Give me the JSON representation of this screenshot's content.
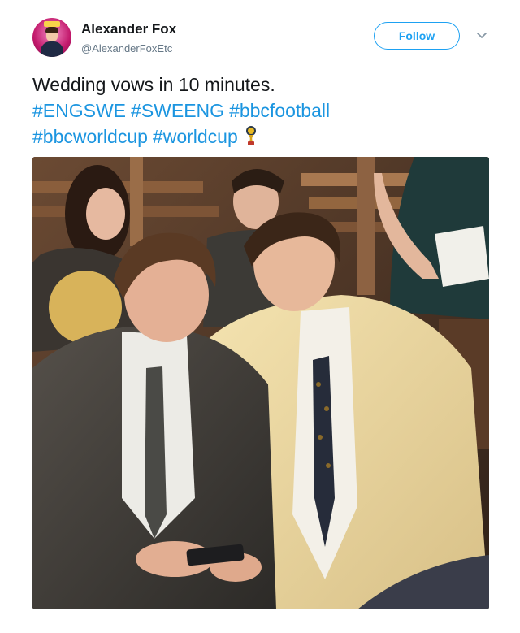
{
  "user": {
    "name": "Alexander Fox",
    "handle": "@AlexanderFoxEtc",
    "avatar_icon": "profile-avatar"
  },
  "actions": {
    "follow_label": "Follow",
    "menu_icon": "chevron-down-icon"
  },
  "tweet": {
    "line1": "Wedding vows in 10 minutes.",
    "hashtags_line2": [
      "#ENGSWE",
      "#SWEENG",
      "#bbcfootball"
    ],
    "hashtags_line3": [
      "#bbcworldcup",
      "#worldcup"
    ],
    "emoji_icon": "world-cup-trophy-icon"
  },
  "colors": {
    "accent": "#1da1f2",
    "hashtag": "#1b95e0",
    "text": "#14171a",
    "secondary": "#657786"
  }
}
